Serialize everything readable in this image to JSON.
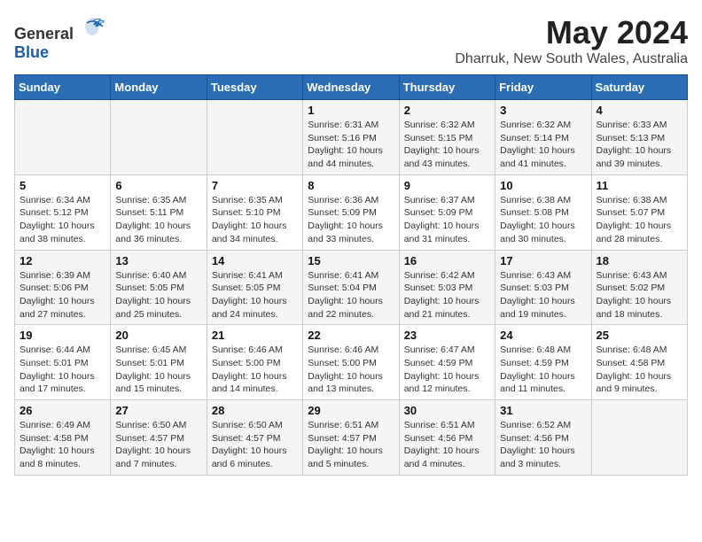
{
  "logo": {
    "text_general": "General",
    "text_blue": "Blue"
  },
  "title": "May 2024",
  "subtitle": "Dharruk, New South Wales, Australia",
  "days_of_week": [
    "Sunday",
    "Monday",
    "Tuesday",
    "Wednesday",
    "Thursday",
    "Friday",
    "Saturday"
  ],
  "weeks": [
    [
      {
        "day": "",
        "info": ""
      },
      {
        "day": "",
        "info": ""
      },
      {
        "day": "",
        "info": ""
      },
      {
        "day": "1",
        "info": "Sunrise: 6:31 AM\nSunset: 5:16 PM\nDaylight: 10 hours\nand 44 minutes."
      },
      {
        "day": "2",
        "info": "Sunrise: 6:32 AM\nSunset: 5:15 PM\nDaylight: 10 hours\nand 43 minutes."
      },
      {
        "day": "3",
        "info": "Sunrise: 6:32 AM\nSunset: 5:14 PM\nDaylight: 10 hours\nand 41 minutes."
      },
      {
        "day": "4",
        "info": "Sunrise: 6:33 AM\nSunset: 5:13 PM\nDaylight: 10 hours\nand 39 minutes."
      }
    ],
    [
      {
        "day": "5",
        "info": "Sunrise: 6:34 AM\nSunset: 5:12 PM\nDaylight: 10 hours\nand 38 minutes."
      },
      {
        "day": "6",
        "info": "Sunrise: 6:35 AM\nSunset: 5:11 PM\nDaylight: 10 hours\nand 36 minutes."
      },
      {
        "day": "7",
        "info": "Sunrise: 6:35 AM\nSunset: 5:10 PM\nDaylight: 10 hours\nand 34 minutes."
      },
      {
        "day": "8",
        "info": "Sunrise: 6:36 AM\nSunset: 5:09 PM\nDaylight: 10 hours\nand 33 minutes."
      },
      {
        "day": "9",
        "info": "Sunrise: 6:37 AM\nSunset: 5:09 PM\nDaylight: 10 hours\nand 31 minutes."
      },
      {
        "day": "10",
        "info": "Sunrise: 6:38 AM\nSunset: 5:08 PM\nDaylight: 10 hours\nand 30 minutes."
      },
      {
        "day": "11",
        "info": "Sunrise: 6:38 AM\nSunset: 5:07 PM\nDaylight: 10 hours\nand 28 minutes."
      }
    ],
    [
      {
        "day": "12",
        "info": "Sunrise: 6:39 AM\nSunset: 5:06 PM\nDaylight: 10 hours\nand 27 minutes."
      },
      {
        "day": "13",
        "info": "Sunrise: 6:40 AM\nSunset: 5:05 PM\nDaylight: 10 hours\nand 25 minutes."
      },
      {
        "day": "14",
        "info": "Sunrise: 6:41 AM\nSunset: 5:05 PM\nDaylight: 10 hours\nand 24 minutes."
      },
      {
        "day": "15",
        "info": "Sunrise: 6:41 AM\nSunset: 5:04 PM\nDaylight: 10 hours\nand 22 minutes."
      },
      {
        "day": "16",
        "info": "Sunrise: 6:42 AM\nSunset: 5:03 PM\nDaylight: 10 hours\nand 21 minutes."
      },
      {
        "day": "17",
        "info": "Sunrise: 6:43 AM\nSunset: 5:03 PM\nDaylight: 10 hours\nand 19 minutes."
      },
      {
        "day": "18",
        "info": "Sunrise: 6:43 AM\nSunset: 5:02 PM\nDaylight: 10 hours\nand 18 minutes."
      }
    ],
    [
      {
        "day": "19",
        "info": "Sunrise: 6:44 AM\nSunset: 5:01 PM\nDaylight: 10 hours\nand 17 minutes."
      },
      {
        "day": "20",
        "info": "Sunrise: 6:45 AM\nSunset: 5:01 PM\nDaylight: 10 hours\nand 15 minutes."
      },
      {
        "day": "21",
        "info": "Sunrise: 6:46 AM\nSunset: 5:00 PM\nDaylight: 10 hours\nand 14 minutes."
      },
      {
        "day": "22",
        "info": "Sunrise: 6:46 AM\nSunset: 5:00 PM\nDaylight: 10 hours\nand 13 minutes."
      },
      {
        "day": "23",
        "info": "Sunrise: 6:47 AM\nSunset: 4:59 PM\nDaylight: 10 hours\nand 12 minutes."
      },
      {
        "day": "24",
        "info": "Sunrise: 6:48 AM\nSunset: 4:59 PM\nDaylight: 10 hours\nand 11 minutes."
      },
      {
        "day": "25",
        "info": "Sunrise: 6:48 AM\nSunset: 4:58 PM\nDaylight: 10 hours\nand 9 minutes."
      }
    ],
    [
      {
        "day": "26",
        "info": "Sunrise: 6:49 AM\nSunset: 4:58 PM\nDaylight: 10 hours\nand 8 minutes."
      },
      {
        "day": "27",
        "info": "Sunrise: 6:50 AM\nSunset: 4:57 PM\nDaylight: 10 hours\nand 7 minutes."
      },
      {
        "day": "28",
        "info": "Sunrise: 6:50 AM\nSunset: 4:57 PM\nDaylight: 10 hours\nand 6 minutes."
      },
      {
        "day": "29",
        "info": "Sunrise: 6:51 AM\nSunset: 4:57 PM\nDaylight: 10 hours\nand 5 minutes."
      },
      {
        "day": "30",
        "info": "Sunrise: 6:51 AM\nSunset: 4:56 PM\nDaylight: 10 hours\nand 4 minutes."
      },
      {
        "day": "31",
        "info": "Sunrise: 6:52 AM\nSunset: 4:56 PM\nDaylight: 10 hours\nand 3 minutes."
      },
      {
        "day": "",
        "info": ""
      }
    ]
  ]
}
